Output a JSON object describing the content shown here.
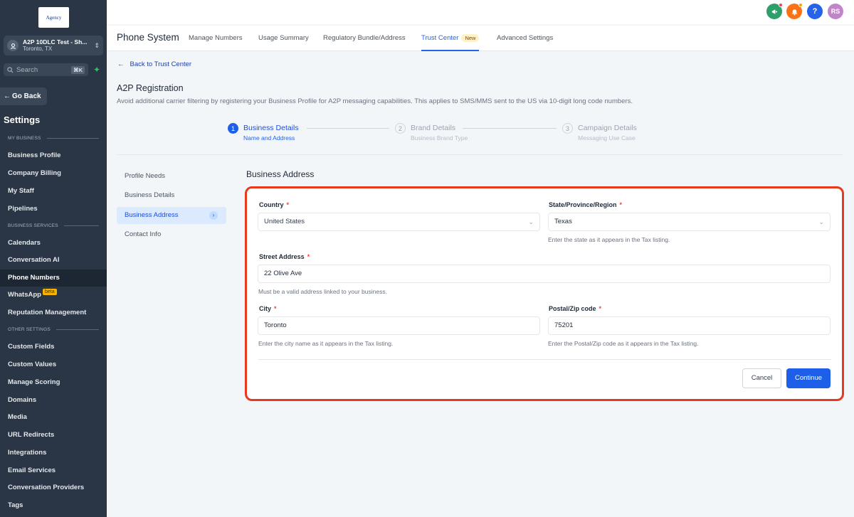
{
  "sidebar": {
    "logo_text": "Agency",
    "account_name": "A2P 10DLC Test - Sh...",
    "account_location": "Toronto, TX",
    "search_placeholder": "Search",
    "search_shortcut": "⌘K",
    "go_back": "Go Back",
    "settings_title": "Settings",
    "sections": {
      "my_business": "MY BUSINESS",
      "business_services": "BUSINESS SERVICES",
      "other_settings": "OTHER SETTINGS"
    },
    "items": [
      "Business Profile",
      "Company Billing",
      "My Staff",
      "Pipelines",
      "Calendars",
      "Conversation AI",
      "Phone Numbers",
      "WhatsApp",
      "Reputation Management",
      "Custom Fields",
      "Custom Values",
      "Manage Scoring",
      "Domains",
      "Media",
      "URL Redirects",
      "Integrations",
      "Email Services",
      "Conversation Providers",
      "Tags"
    ],
    "beta_badge": "beta",
    "active_item": "Phone Numbers"
  },
  "topbar": {
    "avatar_initials": "RS",
    "colors": {
      "megaphone": "#2e9e6a",
      "bell": "#f97316",
      "help": "#2563eb",
      "avatar": "#c084c8"
    }
  },
  "subnav": {
    "title": "Phone System",
    "tabs": [
      "Manage Numbers",
      "Usage Summary",
      "Regulatory Bundle/Address",
      "Trust Center",
      "Advanced Settings"
    ],
    "active_tab": "Trust Center",
    "new_badge": "New"
  },
  "main": {
    "back_link": "Back to Trust Center",
    "title": "A2P Registration",
    "description": "Avoid additional carrier filtering by registering your Business Profile for A2P messaging capabilities. This applies to SMS/MMS sent to the US via 10-digit long code numbers.",
    "steps": [
      {
        "number": "1",
        "title": "Business Details",
        "subtitle": "Name and Address"
      },
      {
        "number": "2",
        "title": "Brand Details",
        "subtitle": "Business Brand Type"
      },
      {
        "number": "3",
        "title": "Campaign Details",
        "subtitle": "Messaging Use Case"
      }
    ],
    "side_items": [
      "Profile Needs",
      "Business Details",
      "Business Address",
      "Contact Info"
    ],
    "active_side_item": "Business Address",
    "section_title": "Business Address",
    "form": {
      "country_label": "Country",
      "country_value": "United States",
      "state_label": "State/Province/Region",
      "state_value": "Texas",
      "state_hint": "Enter the state as it appears in the Tax listing.",
      "street_label": "Street Address",
      "street_value": "22 Olive Ave",
      "street_hint": "Must be a valid address linked to your business.",
      "city_label": "City",
      "city_value": "Toronto",
      "city_hint": "Enter the city name as it appears in the Tax listing.",
      "postal_label": "Postal/Zip code",
      "postal_value": "75201",
      "postal_hint": "Enter the Postal/Zip code as it appears in the Tax listing.",
      "required_mark": "*",
      "cancel_label": "Cancel",
      "continue_label": "Continue"
    }
  },
  "colors": {
    "accent": "#2563eb",
    "highlight_border": "#e8391e",
    "sidebar_bg": "#2a3645"
  }
}
